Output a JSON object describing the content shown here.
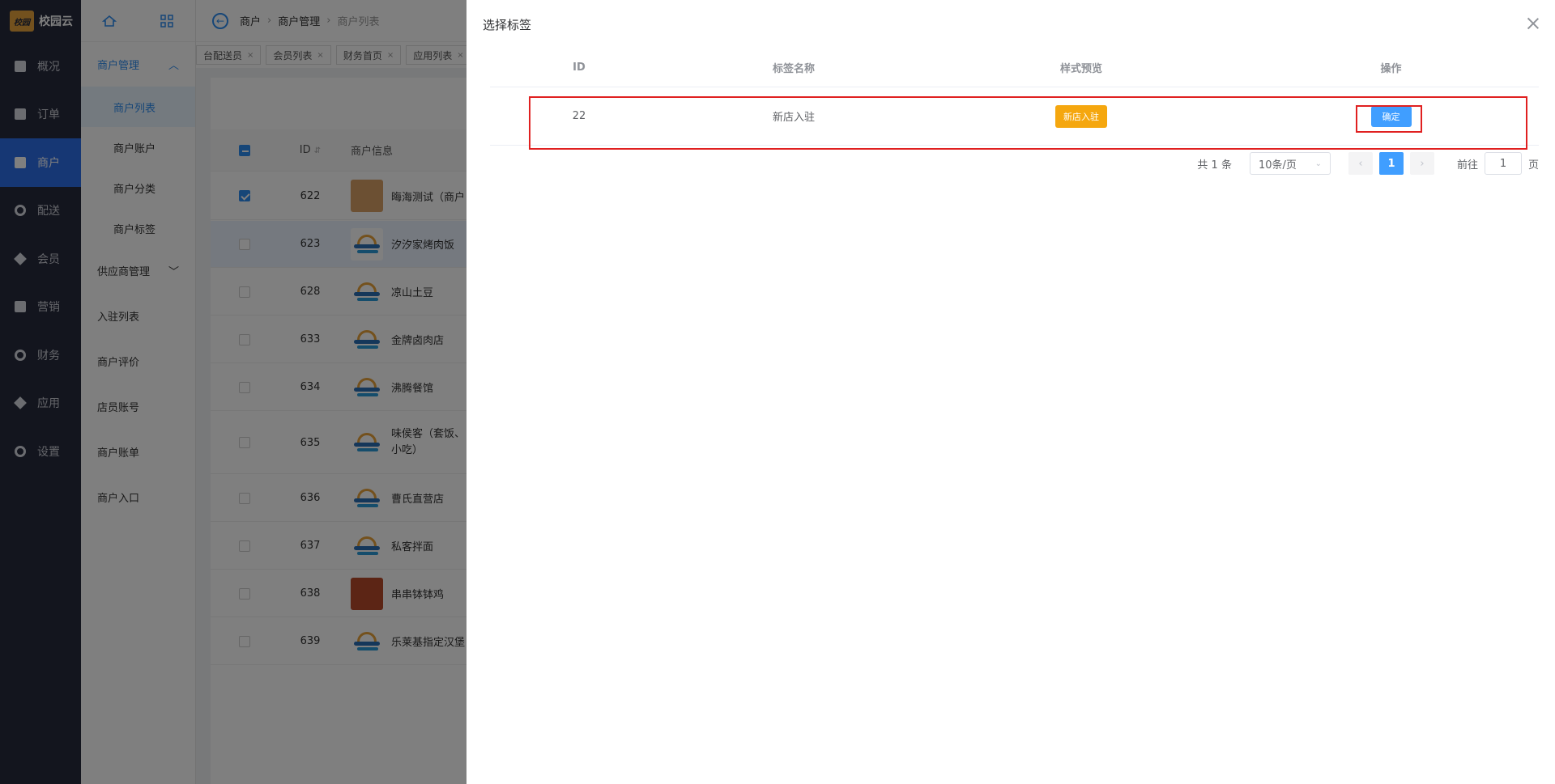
{
  "app": {
    "logo_mark": "校园",
    "name": "校园云"
  },
  "rail": [
    {
      "label": "概况",
      "icon": "monitor-icon"
    },
    {
      "label": "订单",
      "icon": "order-icon"
    },
    {
      "label": "商户",
      "icon": "shop-icon",
      "active": true
    },
    {
      "label": "配送",
      "icon": "delivery-icon"
    },
    {
      "label": "会员",
      "icon": "member-icon"
    },
    {
      "label": "营销",
      "icon": "ticket-icon"
    },
    {
      "label": "财务",
      "icon": "money-bag-icon"
    },
    {
      "label": "应用",
      "icon": "cube-icon"
    },
    {
      "label": "设置",
      "icon": "settings-icon"
    }
  ],
  "submenu": {
    "group_open": "商户管理",
    "children": [
      "商户列表",
      "商户账户",
      "商户分类",
      "商户标签"
    ],
    "group_supply": "供应商管理",
    "plain": [
      "入驻列表",
      "商户评价",
      "店员账号",
      "商户账单",
      "商户入口"
    ]
  },
  "breadcrumb": [
    "商户",
    "商户管理",
    "商户列表"
  ],
  "tags": [
    "台配送员",
    "会员列表",
    "财务首页",
    "应用列表"
  ],
  "table": {
    "headers": {
      "id": "ID",
      "info": "商户信息"
    },
    "rows": [
      {
        "id": "622",
        "name": "晦海测试（商户",
        "avatar": "dog",
        "checked": true
      },
      {
        "id": "623",
        "name": "汐汐家烤肉饭",
        "avatar": "logo",
        "highlight": true
      },
      {
        "id": "628",
        "name": "凉山土豆",
        "avatar": "logo"
      },
      {
        "id": "633",
        "name": "金牌卤肉店",
        "avatar": "logo"
      },
      {
        "id": "634",
        "name": "沸腾餐馆",
        "avatar": "logo"
      },
      {
        "id": "635",
        "name": "味侯客（套饭、",
        "name2": "小吃）",
        "avatar": "logo"
      },
      {
        "id": "636",
        "name": "曹氏直营店",
        "avatar": "logo"
      },
      {
        "id": "637",
        "name": "私客拌面",
        "avatar": "logo"
      },
      {
        "id": "638",
        "name": "串串钵钵鸡",
        "avatar": "food"
      },
      {
        "id": "639",
        "name": "乐莱基指定汉堡",
        "avatar": "logo"
      }
    ]
  },
  "drawer": {
    "title": "选择标签",
    "columns": [
      "ID",
      "标签名称",
      "样式预览",
      "操作"
    ],
    "row": {
      "id": "22",
      "name": "新店入驻",
      "preview": "新店入驻",
      "action": "确定"
    },
    "pager": {
      "total": "共 1 条",
      "size": "10条/页",
      "current": "1",
      "goto": "前往",
      "goto_value": "1",
      "page_suffix": "页"
    }
  },
  "colors": {
    "accent": "#409eff",
    "label_chip": "#f5a70f",
    "highlight_box": "#e02020",
    "rail_bg": "#262b3d"
  }
}
